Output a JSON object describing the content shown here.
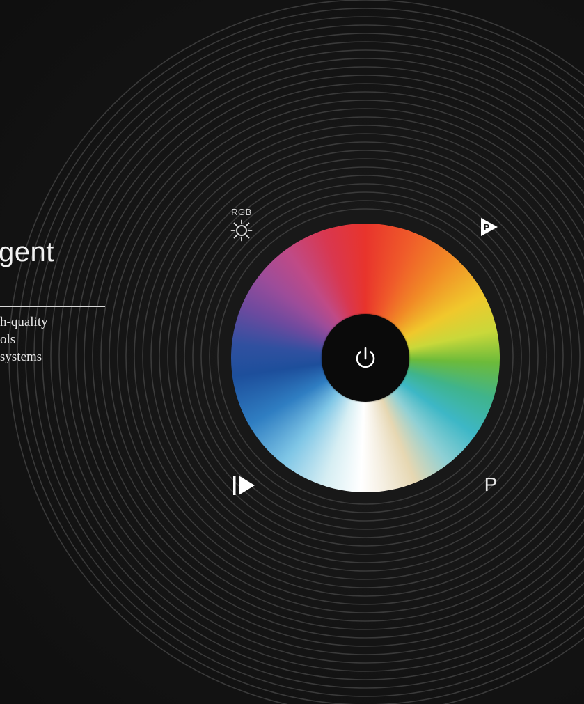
{
  "intro": {
    "headline": "gent",
    "description_lines": [
      "h-quality",
      "ols",
      "systems"
    ]
  },
  "controls": {
    "rgb_label": "RGB",
    "program_label": "P",
    "preset_badge_letter": "P"
  },
  "colors": {
    "background": "#111111",
    "rings": "#3a3a3a",
    "text": "#f2f2f2",
    "power_center": "#0a0a0a"
  },
  "icons": {
    "power": "power-icon",
    "brightness": "sun-icon",
    "preset_play": "play-preset-icon",
    "play": "play-icon"
  }
}
